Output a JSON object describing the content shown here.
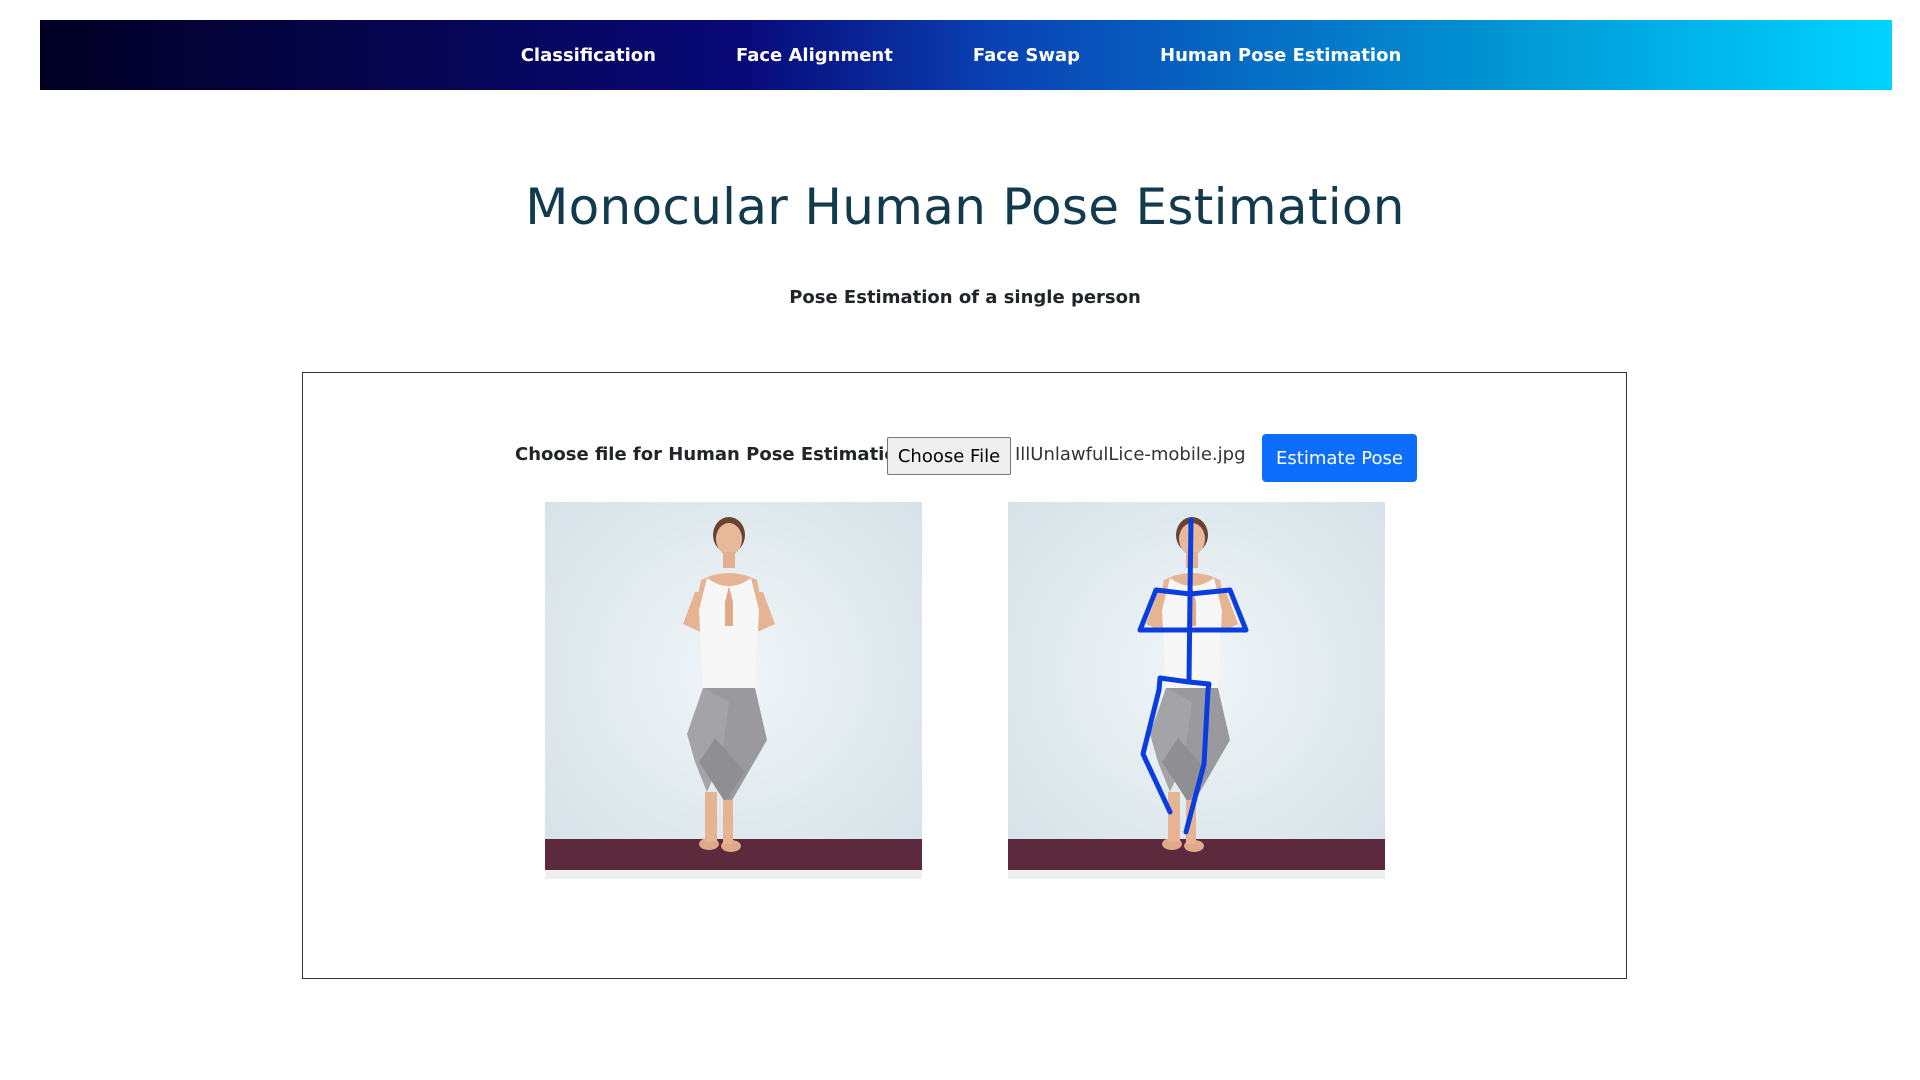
{
  "nav": {
    "items": [
      {
        "label": "Classification"
      },
      {
        "label": "Face Alignment"
      },
      {
        "label": "Face Swap"
      },
      {
        "label": "Human Pose Estimation"
      }
    ]
  },
  "header": {
    "title": "Monocular Human Pose Estimation",
    "subtitle": "Pose Estimation of a single person"
  },
  "form": {
    "label": "Choose file for Human Pose Estimation",
    "choose_button": "Choose File",
    "file_name": "IllUnlawfulLice-mobile.jpg",
    "submit_button": "Estimate Pose"
  },
  "images": {
    "original": {
      "name": "uploaded-photo"
    },
    "result": {
      "name": "pose-estimation-result",
      "skeleton_color": "#0a3de0"
    }
  },
  "colors": {
    "nav_gradient_start": "#020024",
    "nav_gradient_end": "#00d4ff",
    "title": "#123a4d",
    "primary_button": "#0d6efd",
    "mat": "#5c2a3c"
  }
}
